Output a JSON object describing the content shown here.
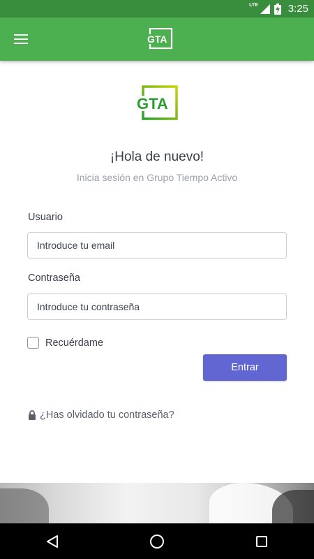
{
  "status_bar": {
    "network": "LTE",
    "time": "3:25"
  },
  "app_bar": {
    "logo_text": "GTA"
  },
  "login": {
    "logo_text": "GTA",
    "title": "¡Hola de nuevo!",
    "subtitle": "Inicia sesión en Grupo Tiempo Activo",
    "user_label": "Usuario",
    "user_placeholder": "Introduce tu email",
    "password_label": "Contraseña",
    "password_placeholder": "Introduce tu contraseña",
    "remember_label": "Recuérdame",
    "remember_checked": false,
    "submit_label": "Entrar",
    "forgot_label": "¿Has olvidado tu contraseña?"
  },
  "colors": {
    "status_bar": "#388e3c",
    "app_bar": "#4caf50",
    "primary_button": "#6266d2",
    "logo_green": "#2e9e34",
    "logo_yellow": "#c8d400"
  },
  "icons": {
    "menu": "hamburger-menu-icon",
    "lock": "lock-icon",
    "nav_back": "back-triangle-icon",
    "nav_home": "home-circle-icon",
    "nav_recents": "recents-square-icon"
  }
}
